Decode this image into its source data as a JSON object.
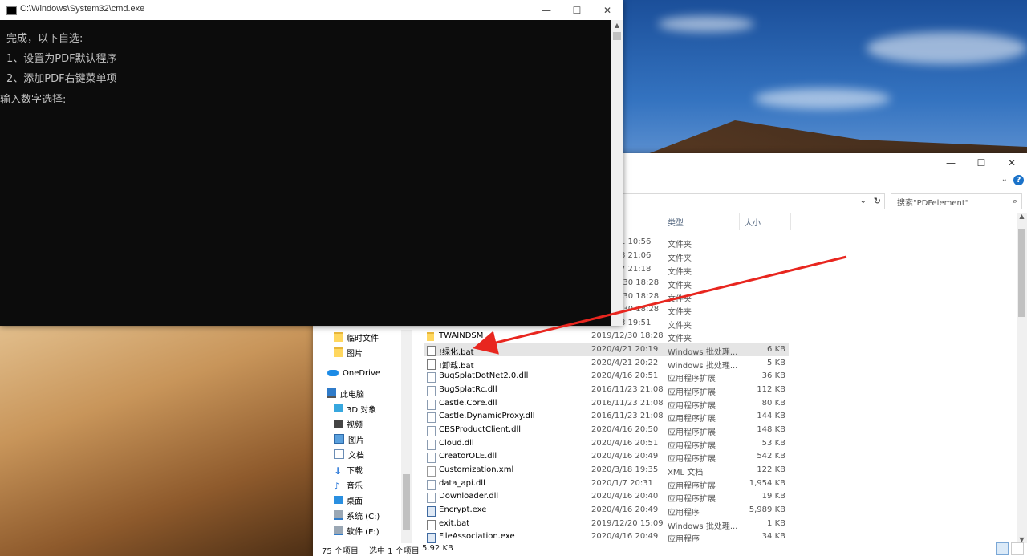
{
  "cmd": {
    "title": "C:\\Windows\\System32\\cmd.exe",
    "lines": [
      "完成，以下自选:",
      "1、设置为PDF默认程序",
      "2、添加PDF右键菜单项",
      "输入数字选择:"
    ],
    "controls": {
      "minimize": "—",
      "maximize": "☐",
      "close": "✕"
    }
  },
  "explorer": {
    "controls": {
      "minimize": "—",
      "maximize": "☐",
      "close": "✕"
    },
    "help": "?",
    "ribbon_toggle": "⌄",
    "address": {
      "dropdown": "⌄",
      "refresh": "↻"
    },
    "search": {
      "placeholder": "搜索\"PDFelement\"",
      "icon": "⌕"
    },
    "columns": {
      "type": "类型",
      "size": "大小"
    },
    "nav": [
      {
        "label": "临时文件",
        "icon": "folder-icon"
      },
      {
        "label": "图片",
        "icon": "folder-icon"
      },
      {
        "label": "OneDrive",
        "icon": "cloud-icon"
      },
      {
        "label": "此电脑",
        "icon": "computer-icon"
      },
      {
        "label": "3D 对象",
        "icon": "3d-objects-icon"
      },
      {
        "label": "视频",
        "icon": "video-icon"
      },
      {
        "label": "图片",
        "icon": "pictures-icon"
      },
      {
        "label": "文档",
        "icon": "documents-icon"
      },
      {
        "label": "下载",
        "icon": "download-icon"
      },
      {
        "label": "音乐",
        "icon": "music-icon"
      },
      {
        "label": "桌面",
        "icon": "desktop-icon"
      },
      {
        "label": "系统 (C:)",
        "icon": "drive-icon"
      },
      {
        "label": "软件 (E:)",
        "icon": "drive-icon"
      }
    ],
    "partial_rows": [
      {
        "date": "1 10:56",
        "type": "文件夹"
      },
      {
        "date": "8 21:06",
        "type": "文件夹"
      },
      {
        "date": "7 21:18",
        "type": "文件夹"
      },
      {
        "date": "/30 18:28",
        "type": "文件夹"
      },
      {
        "date": "/30 18:28",
        "type": "文件夹"
      },
      {
        "date": "/30 18:28",
        "type": "文件夹"
      },
      {
        "date": "8 19:51",
        "type": "文件夹"
      }
    ],
    "files": [
      {
        "name": "TWAINDSM",
        "date": "2019/12/30 18:28",
        "type": "文件夹",
        "size": "",
        "kind": "folder"
      },
      {
        "name": "!绿化.bat",
        "date": "2020/4/21 20:19",
        "type": "Windows 批处理...",
        "size": "6 KB",
        "kind": "bat"
      },
      {
        "name": "!卸载.bat",
        "date": "2020/4/21 20:22",
        "type": "Windows 批处理...",
        "size": "5 KB",
        "kind": "bat"
      },
      {
        "name": "BugSplatDotNet2.0.dll",
        "date": "2020/4/16 20:51",
        "type": "应用程序扩展",
        "size": "36 KB",
        "kind": "dll"
      },
      {
        "name": "BugSplatRc.dll",
        "date": "2016/11/23 21:08",
        "type": "应用程序扩展",
        "size": "112 KB",
        "kind": "dll"
      },
      {
        "name": "Castle.Core.dll",
        "date": "2016/11/23 21:08",
        "type": "应用程序扩展",
        "size": "80 KB",
        "kind": "dll"
      },
      {
        "name": "Castle.DynamicProxy.dll",
        "date": "2016/11/23 21:08",
        "type": "应用程序扩展",
        "size": "144 KB",
        "kind": "dll"
      },
      {
        "name": "CBSProductClient.dll",
        "date": "2020/4/16 20:50",
        "type": "应用程序扩展",
        "size": "148 KB",
        "kind": "dll"
      },
      {
        "name": "Cloud.dll",
        "date": "2020/4/16 20:51",
        "type": "应用程序扩展",
        "size": "53 KB",
        "kind": "dll"
      },
      {
        "name": "CreatorOLE.dll",
        "date": "2020/4/16 20:49",
        "type": "应用程序扩展",
        "size": "542 KB",
        "kind": "dll"
      },
      {
        "name": "Customization.xml",
        "date": "2020/3/18 19:35",
        "type": "XML 文档",
        "size": "122 KB",
        "kind": "xml"
      },
      {
        "name": "data_api.dll",
        "date": "2020/1/7 20:31",
        "type": "应用程序扩展",
        "size": "1,954 KB",
        "kind": "dll"
      },
      {
        "name": "Downloader.dll",
        "date": "2020/4/16 20:40",
        "type": "应用程序扩展",
        "size": "19 KB",
        "kind": "dll"
      },
      {
        "name": "Encrypt.exe",
        "date": "2020/4/16 20:49",
        "type": "应用程序",
        "size": "5,989 KB",
        "kind": "exe"
      },
      {
        "name": "exit.bat",
        "date": "2019/12/20 15:09",
        "type": "Windows 批处理...",
        "size": "1 KB",
        "kind": "bat"
      },
      {
        "name": "FileAssociation.exe",
        "date": "2020/4/16 20:49",
        "type": "应用程序",
        "size": "34 KB",
        "kind": "exe"
      }
    ],
    "status": {
      "count": "75 个项目",
      "selected": "选中 1 个项目",
      "size": "5.92 KB"
    }
  }
}
